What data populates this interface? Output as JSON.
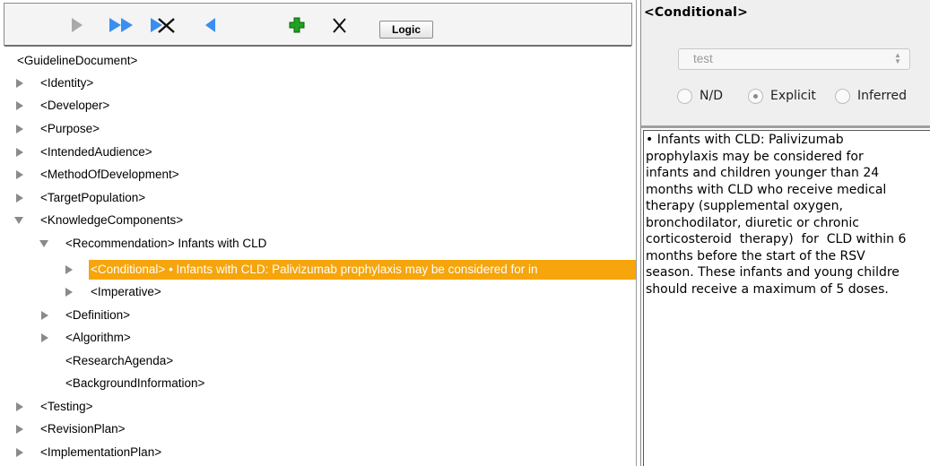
{
  "toolbar": {
    "buttons": [
      {
        "name": "play-icon",
        "color": "#a9a9a9"
      },
      {
        "name": "fast-forward-icon",
        "color": "#3b8ef0"
      },
      {
        "name": "skip-cancel-icon",
        "color": "#3b8ef0"
      },
      {
        "name": "back-icon",
        "color": "#3b8ef0"
      },
      {
        "name": "add-icon",
        "color": "#1fa31f"
      },
      {
        "name": "close-icon",
        "color": "#111111"
      }
    ],
    "logic_label": "Logic"
  },
  "tree": {
    "root": "<GuidelineDocument>",
    "items": [
      "<Identity>",
      "<Developer>",
      "<Purpose>",
      "<IntendedAudience>",
      "<MethodOfDevelopment>",
      "<TargetPopulation>",
      "<KnowledgeComponents>",
      "<Recommendation> Infants with CLD",
      "<Conditional> • Infants with CLD: Palivizumab prophylaxis may be considered for in",
      "<Imperative>",
      "<Definition>",
      "<Algorithm>",
      "<ResearchAgenda>",
      "<BackgroundInformation>",
      "<Testing>",
      "<RevisionPlan>",
      "<ImplementationPlan>"
    ]
  },
  "detail": {
    "title": "<Conditional>",
    "select_value": "test",
    "radio_options": [
      "N/D",
      "Explicit",
      "Inferred"
    ],
    "selected_option": "Explicit",
    "description": "• Infants with CLD: Palivizumab\nprophylaxis may be considered for\ninfants and children younger than 24\nmonths with CLD who receive medical\ntherapy (supplemental oxygen,\nbronchodilator, diuretic or chronic\ncorticosteroid  therapy)  for  CLD within 6\nmonths before the start of the RSV\nseason. These infants and young childre\nshould receive a maximum of 5 doses."
  },
  "colors": {
    "selection": "#f6a50c",
    "accent_blue": "#3b8ef0"
  }
}
